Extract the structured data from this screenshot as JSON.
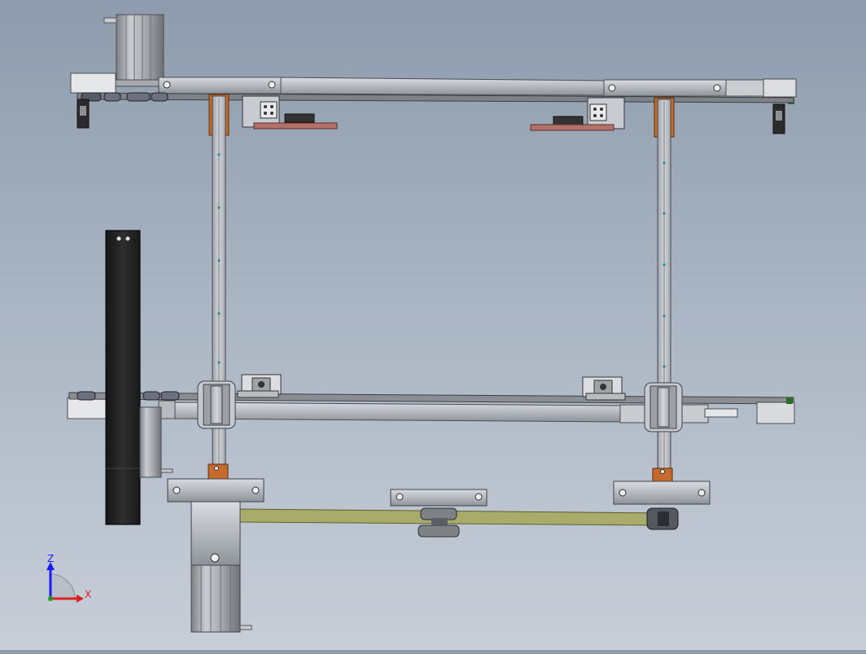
{
  "viewport": {
    "background_top": "#8d9bac",
    "background_bottom": "#c7ced8"
  },
  "triad": {
    "z_label": "Z",
    "x_label": "X",
    "z_color": "#1a1aff",
    "x_color": "#e02020"
  },
  "colors": {
    "frame_steel": "#b8bcc2",
    "frame_edge": "#55595f",
    "rail_orange": "#c46a2c",
    "belt": "#a8ab6a",
    "motor_dark": "#2a2a2a",
    "bracket_copper": "#b3716a"
  },
  "parts": [
    "top-stepper-motor",
    "top-beam",
    "left-vertical-rail",
    "right-vertical-rail",
    "bottom-beam",
    "black-counterweight",
    "drive-motor",
    "timing-belt",
    "idler-pulley"
  ]
}
